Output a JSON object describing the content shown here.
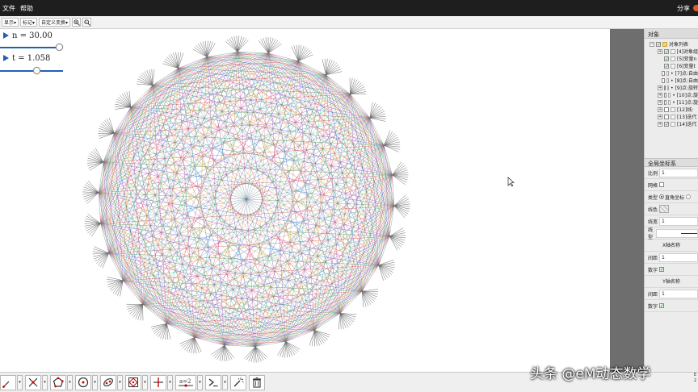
{
  "menubar": {
    "file": "文件",
    "help": "帮助",
    "share": "分享"
  },
  "toolbar": {
    "display": "显示▾",
    "mark": "标记▾",
    "custom_transform": "自定义变换▾",
    "zoom_in_icon": "zoom-in-icon",
    "zoom_out_icon": "zoom-out-icon"
  },
  "sliders": [
    {
      "var": "n",
      "label": "n = 30.00",
      "fraction": 0.93
    },
    {
      "var": "t",
      "label": "t = 1.058",
      "fraction": 0.58
    }
  ],
  "figure": {
    "n": 30,
    "t": 1.058
  },
  "panel": {
    "title": "对象",
    "tree": [
      {
        "pm": "⊟",
        "checked": true,
        "label": "对象列表",
        "folder": true
      },
      {
        "pm": "⊞",
        "checked": true,
        "label": "[4]对象组"
      },
      {
        "pm": "",
        "checked": true,
        "label": "[5]变量n"
      },
      {
        "pm": "",
        "checked": true,
        "label": "[6]变量t"
      },
      {
        "pm": "",
        "checked": false,
        "label": "• [7]点:自由"
      },
      {
        "pm": "",
        "checked": false,
        "label": "• [8]点:自由"
      },
      {
        "pm": "⊞",
        "checked": false,
        "label": "• [9]点:旋转"
      },
      {
        "pm": "⊞",
        "checked": false,
        "label": "• [10]点:旋"
      },
      {
        "pm": "⊞",
        "checked": false,
        "label": "• [11]点:旋"
      },
      {
        "pm": "⊞",
        "checked": false,
        "label": "[12]线:"
      },
      {
        "pm": "⊞",
        "checked": false,
        "label": "[13]迭代"
      },
      {
        "pm": "⊞",
        "checked": true,
        "label": "[14]迭代"
      }
    ],
    "section": "全局坐标系",
    "props": {
      "scale_label": "比例",
      "scale_value": "1",
      "grid_label": "网格",
      "type_label": "类型",
      "type_value": "直角坐标",
      "color_label": "线色",
      "width_label": "线宽",
      "width_value": "1",
      "style_label": "线型",
      "x_axis_name": "X轴名称",
      "x_spacing_label": "间距",
      "x_spacing_value": "1",
      "x_numbers_label": "数字",
      "y_axis_name": "Y轴名称",
      "y_spacing_label": "间距",
      "y_spacing_value": "1",
      "y_numbers_label": "数字"
    }
  },
  "bottom_tools": [
    "move-tool-icon",
    "line-tool-icon",
    "polygon-tool-icon",
    "circle-tool-icon",
    "conic-tool-icon",
    "transform-tool-icon",
    "axis-tool-icon",
    "text-tool-icon",
    "command-tool-icon",
    "sparkle-tool-icon",
    "delete-tool-icon"
  ],
  "watermark": "头条 @eM动态数学",
  "corner": [
    "E",
    "2"
  ],
  "colors": {
    "slider_blue": "#1f5fb8",
    "menubar": "#1e1e1e",
    "gap_gray": "#6e6e6e"
  }
}
